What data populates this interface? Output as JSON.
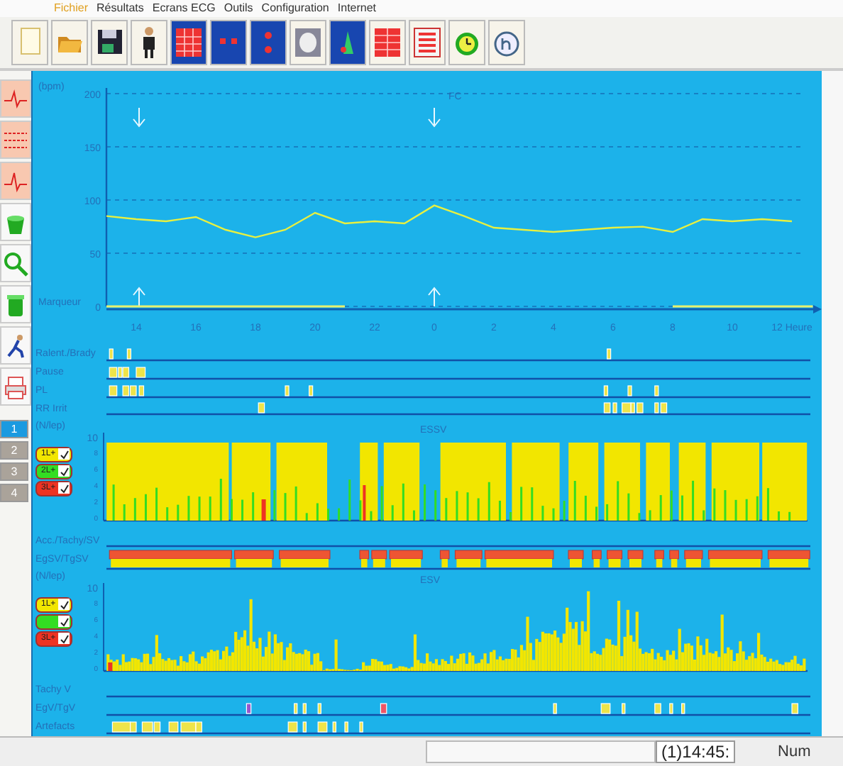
{
  "menu": [
    {
      "label": "Fichier",
      "selected": true
    },
    {
      "label": "Résultats",
      "selected": false
    },
    {
      "label": "Ecrans ECG",
      "selected": false
    },
    {
      "label": "Outils",
      "selected": false
    },
    {
      "label": "Configuration",
      "selected": false
    },
    {
      "label": "Internet",
      "selected": false
    }
  ],
  "pages": [
    {
      "label": "1",
      "selected": true
    },
    {
      "label": "2",
      "selected": false
    },
    {
      "label": "3",
      "selected": false
    },
    {
      "label": "4",
      "selected": false
    }
  ],
  "fc_chart": {
    "marker_label": "Marqueur",
    "chart_data": {
      "type": "line",
      "title": "FC",
      "ylabel": "(bpm)",
      "categories": [
        null,
        "14",
        null,
        "16",
        null,
        "18",
        null,
        "20",
        null,
        "22",
        null,
        "0",
        null,
        "2",
        null,
        "4",
        null,
        "6",
        null,
        "8",
        null,
        "10",
        null,
        "12 Heure"
      ],
      "values": [
        85,
        82,
        80,
        84,
        72,
        65,
        72,
        88,
        78,
        80,
        78,
        95,
        85,
        74,
        72,
        70,
        72,
        74,
        75,
        70,
        82,
        80,
        82,
        80
      ],
      "color": "#e8f040",
      "ylim": [
        0,
        200
      ],
      "yticks": [
        0,
        50,
        100,
        150,
        200
      ],
      "grid": true
    }
  },
  "tracks_top": [
    {
      "label": "Ralent./Brady"
    },
    {
      "label": "Pause"
    },
    {
      "label": "PL"
    },
    {
      "label": "RR Irrit"
    }
  ],
  "essv": {
    "title": "ESSV",
    "unit_label": "(N/lep)",
    "top_tick": "10",
    "ticks": [
      "8",
      "6",
      "4",
      "2",
      "0"
    ],
    "legend": [
      {
        "label": "1L+",
        "color": "#f2e600",
        "checked": true
      },
      {
        "label": "2L+",
        "color": "#33dd22",
        "checked": true
      },
      {
        "label": "3L+",
        "color": "#ee3322",
        "checked": true
      }
    ]
  },
  "tracks_mid": [
    {
      "label": "Acc./Tachy/SV"
    },
    {
      "label": "EgSV/TgSV"
    }
  ],
  "esv": {
    "title": "ESV",
    "unit_label": "(N/lep)",
    "top_tick": "10",
    "ticks": [
      "8",
      "6",
      "4",
      "2",
      "0"
    ],
    "legend": [
      {
        "label": "1L+",
        "color": "#f2e600",
        "checked": true
      },
      {
        "color": "#33dd22",
        "checked": true
      },
      {
        "label": "3L+",
        "color": "#ee3322",
        "checked": true
      }
    ]
  },
  "tracks_bottom": [
    {
      "label": "Tachy V"
    },
    {
      "label": "EgV/TgV"
    },
    {
      "label": "Artefacts"
    }
  ],
  "status_bar": {
    "time": "(1)14:45:",
    "mode": "Num"
  }
}
